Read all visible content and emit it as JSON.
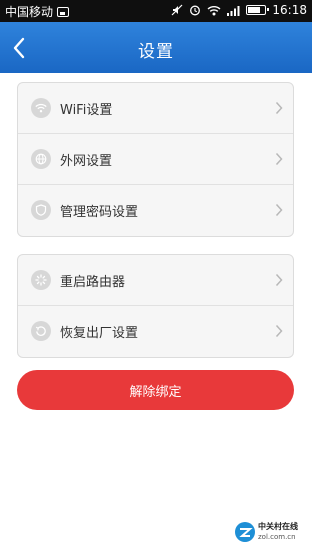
{
  "status_bar": {
    "carrier": "中国移动",
    "time": "16:18"
  },
  "header": {
    "title": "设置"
  },
  "settings_group_1": [
    {
      "label": "WiFi设置",
      "icon": "wifi-icon"
    },
    {
      "label": "外网设置",
      "icon": "globe-icon"
    },
    {
      "label": "管理密码设置",
      "icon": "shield-icon"
    }
  ],
  "settings_group_2": [
    {
      "label": "重启路由器",
      "icon": "restart-icon"
    },
    {
      "label": "恢复出厂设置",
      "icon": "reset-icon"
    }
  ],
  "actions": {
    "unbind_label": "解除绑定"
  },
  "watermark": {
    "line1": "中关村在线",
    "line2": "zol.com.cn"
  },
  "colors": {
    "header_blue": "#1f6fcc",
    "unbind_red": "#e8393a",
    "card_bg": "#f6f6f6"
  }
}
